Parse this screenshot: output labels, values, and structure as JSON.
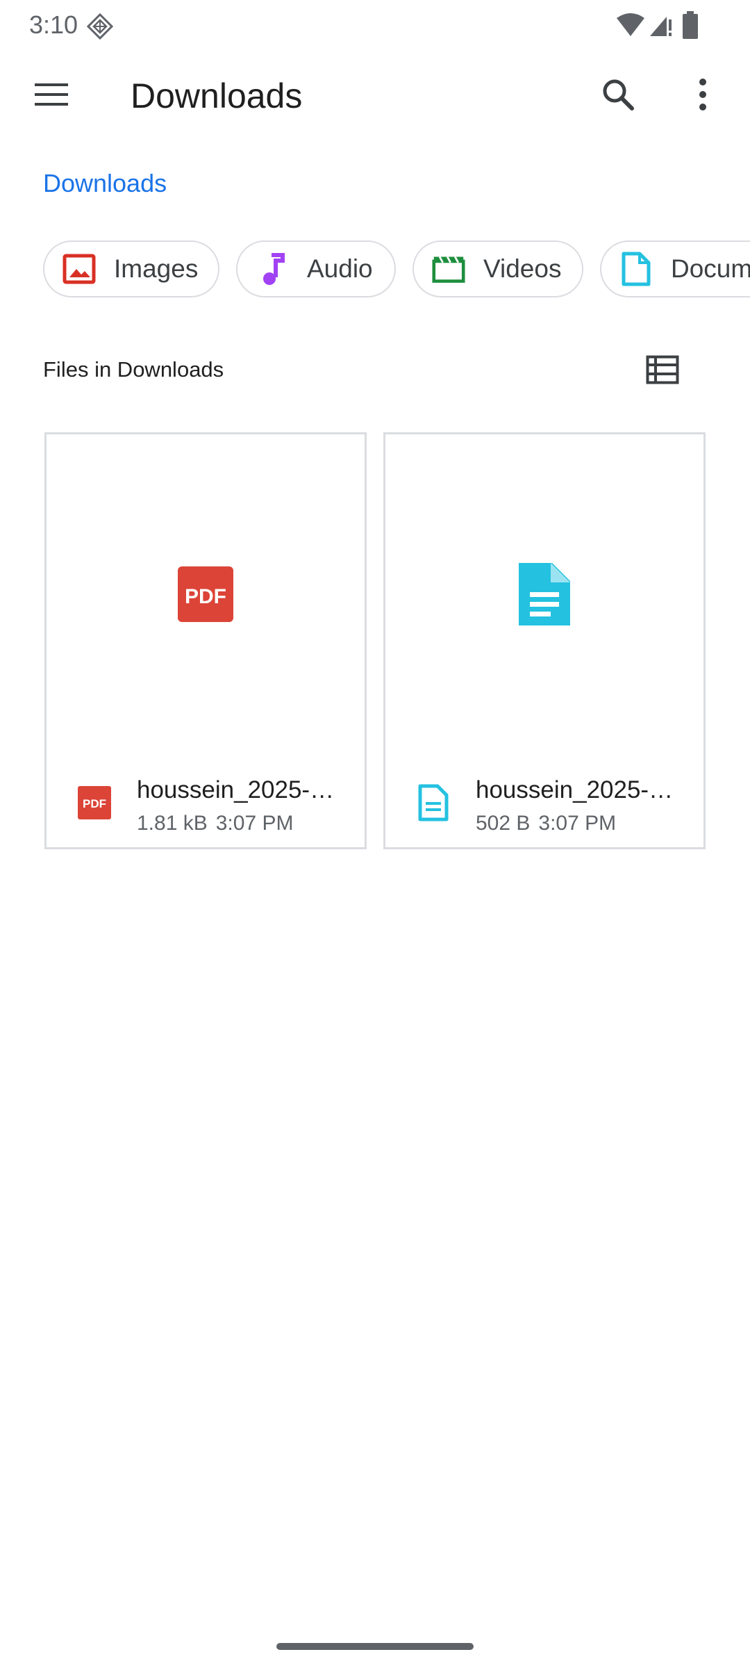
{
  "status_bar": {
    "time": "3:10",
    "icons": [
      "notification-glyph-icon",
      "wifi-icon",
      "signal-icon",
      "battery-icon"
    ]
  },
  "toolbar": {
    "title": "Downloads",
    "icons": [
      "menu-icon",
      "search-icon",
      "more-vert-icon"
    ]
  },
  "breadcrumb": {
    "label": "Downloads"
  },
  "chips": [
    {
      "label": "Images",
      "icon": "image-icon",
      "color": "#d93025"
    },
    {
      "label": "Audio",
      "icon": "music-note-icon",
      "color": "#a142f4"
    },
    {
      "label": "Videos",
      "icon": "video-icon",
      "color": "#1e8e3e"
    },
    {
      "label": "Docum",
      "icon": "document-icon",
      "color": "#24c1e0"
    }
  ],
  "section": {
    "title": "Files in Downloads",
    "view_icon": "list-view-icon"
  },
  "files": [
    {
      "name": "houssein_2025-…",
      "size": "1.81 kB",
      "time": "3:07 PM",
      "type_icon": "pdf-icon",
      "preview_text": "PDF",
      "color": "#db4437"
    },
    {
      "name": "houssein_2025-…",
      "size": "502 B",
      "time": "3:07 PM",
      "type_icon": "text-document-icon",
      "color": "#24c1e0"
    }
  ],
  "colors": {
    "accent": "#1a73e8",
    "chip_border": "#dadce0",
    "secondary_text": "#5f6368"
  }
}
